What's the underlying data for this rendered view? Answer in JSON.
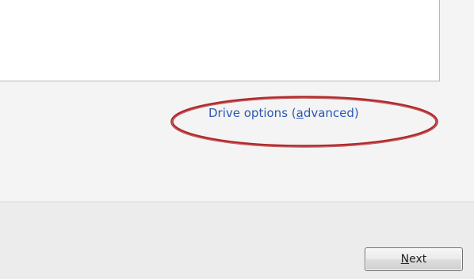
{
  "drive_options_link": {
    "text_prefix": "Drive options (",
    "accel_char": "a",
    "text_suffix": "dvanced)"
  },
  "next_button": {
    "accel_char": "N",
    "text_suffix": "ext"
  },
  "colors": {
    "link": "#2a58b4",
    "highlight": "#b0282b",
    "panel": "#ffffff",
    "background": "#f4f4f4"
  }
}
